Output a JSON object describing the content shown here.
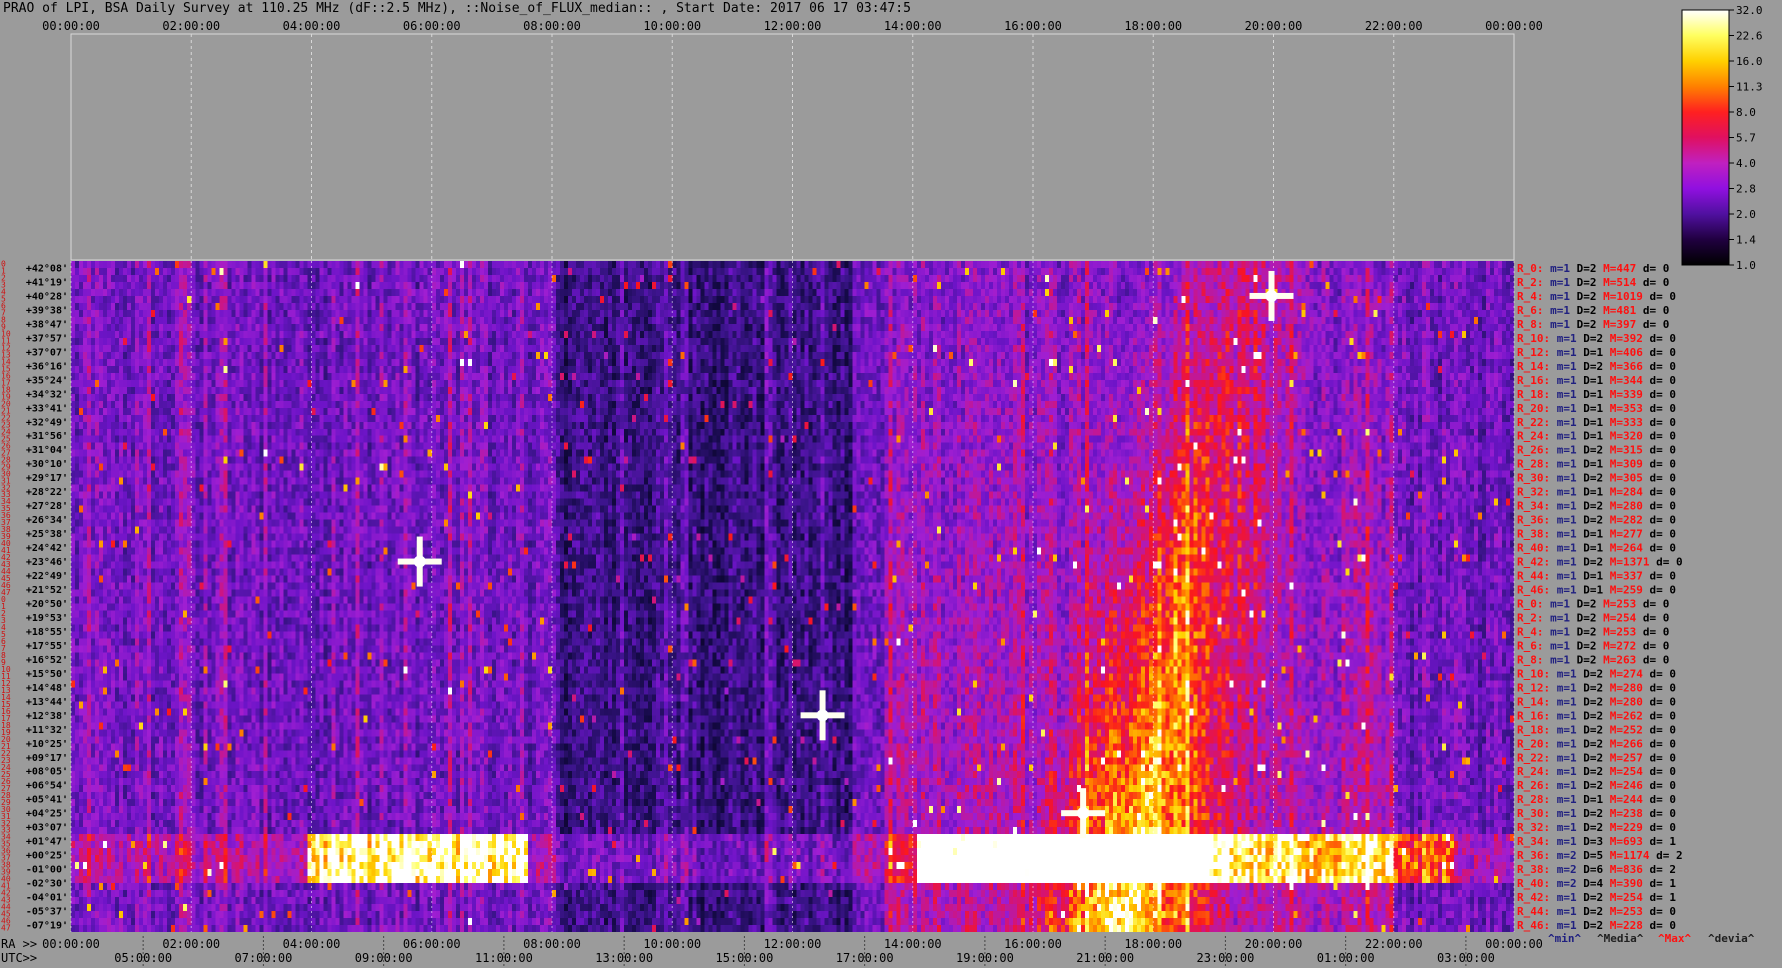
{
  "title": "PRAO of LPI, BSA Daily Survey at 110.25 MHz (dF::2.5 MHz), ::Noise_of_FLUX_median:: , Start Date: 2017 06 17 03:47:5",
  "colors": {
    "background": "#9b9b9b",
    "stat_red": "#ff1010",
    "stat_dark": "#202080",
    "grid": "#ffffff"
  },
  "chart_data": {
    "type": "heatmap",
    "title": "PRAO of LPI, BSA Daily Survey at 110.25 MHz (dF::2.5 MHz), ::Noise_of_FLUX_median:: , Start Date: 2017 06 17 03:47:5",
    "x_top_ticks": [
      "00:00:00",
      "02:00:00",
      "04:00:00",
      "06:00:00",
      "08:00:00",
      "10:00:00",
      "12:00:00",
      "14:00:00",
      "16:00:00",
      "18:00:00",
      "20:00:00",
      "22:00:00",
      "00:00:00"
    ],
    "ra_prefix": "RA >>",
    "utc_prefix": "UTC>>",
    "x_ra_ticks": [
      "00:00:00",
      "02:00:00",
      "04:00:00",
      "06:00:00",
      "08:00:00",
      "10:00:00",
      "12:00:00",
      "14:00:00",
      "16:00:00",
      "18:00:00",
      "20:00:00",
      "22:00:00",
      "00:00:00"
    ],
    "x_utc_ticks": [
      "05:00:00",
      "07:00:00",
      "09:00:00",
      "11:00:00",
      "13:00:00",
      "15:00:00",
      "17:00:00",
      "19:00:00",
      "21:00:00",
      "23:00:00",
      "01:00:00",
      "03:00:00"
    ],
    "dec_labels": [
      "+42°08'",
      "+41°19'",
      "+40°28'",
      "+39°38'",
      "+38°47'",
      "+37°57'",
      "+37°07'",
      "+36°16'",
      "+35°24'",
      "+34°32'",
      "+33°41'",
      "+32°49'",
      "+31°56'",
      "+31°04'",
      "+30°10'",
      "+29°17'",
      "+28°22'",
      "+27°28'",
      "+26°34'",
      "+25°38'",
      "+24°42'",
      "+23°46'",
      "+22°49'",
      "+21°52'",
      "+20°50'",
      "+19°53'",
      "+18°55'",
      "+17°55'",
      "+16°52'",
      "+15°50'",
      "+14°48'",
      "+13°44'",
      "+12°38'",
      "+11°32'",
      "+10°25'",
      "+09°17'",
      "+08°05'",
      "+06°54'",
      "+05°41'",
      "+04°25'",
      "+03°07'",
      "+01°47'",
      "+00°25'",
      "-01°00'",
      "-02°30'",
      "-04°01'",
      "-05°37'",
      "-07°19'"
    ],
    "row_numbers": [
      "0",
      "1",
      "2",
      "3",
      "4",
      "5",
      "6",
      "7",
      "8",
      "9",
      "10",
      "11",
      "12",
      "13",
      "14",
      "15",
      "16",
      "17",
      "18",
      "19",
      "20",
      "21",
      "22",
      "23",
      "24",
      "25",
      "26",
      "27",
      "28",
      "29",
      "30",
      "31",
      "32",
      "33",
      "34",
      "35",
      "36",
      "37",
      "38",
      "39",
      "40",
      "41",
      "42",
      "43",
      "44",
      "45",
      "46",
      "47",
      "0",
      "1",
      "2",
      "3",
      "4",
      "5",
      "6",
      "7",
      "8",
      "9",
      "10",
      "11",
      "12",
      "13",
      "14",
      "15",
      "16",
      "17",
      "18",
      "19",
      "20",
      "21",
      "22",
      "23",
      "24",
      "25",
      "26",
      "27",
      "28",
      "29",
      "30",
      "31",
      "32",
      "33",
      "34",
      "35",
      "36",
      "37",
      "38",
      "39",
      "40",
      "41",
      "42",
      "43",
      "44",
      "45",
      "46",
      "47"
    ],
    "beam_stats": [
      {
        "r": "R_0:",
        "m": "m=1",
        "d": "D=2",
        "M": "M=447",
        "dev": "d= 0"
      },
      {
        "r": "R_2:",
        "m": "m=1",
        "d": "D=2",
        "M": "M=514",
        "dev": "d= 0"
      },
      {
        "r": "R_4:",
        "m": "m=1",
        "d": "D=2",
        "M": "M=1019",
        "dev": "d= 0"
      },
      {
        "r": "R_6:",
        "m": "m=1",
        "d": "D=2",
        "M": "M=481",
        "dev": "d= 0"
      },
      {
        "r": "R_8:",
        "m": "m=1",
        "d": "D=2",
        "M": "M=397",
        "dev": "d= 0"
      },
      {
        "r": "R_10:",
        "m": "m=1",
        "d": "D=2",
        "M": "M=392",
        "dev": "d= 0"
      },
      {
        "r": "R_12:",
        "m": "m=1",
        "d": "D=1",
        "M": "M=406",
        "dev": "d= 0"
      },
      {
        "r": "R_14:",
        "m": "m=1",
        "d": "D=2",
        "M": "M=366",
        "dev": "d= 0"
      },
      {
        "r": "R_16:",
        "m": "m=1",
        "d": "D=1",
        "M": "M=344",
        "dev": "d= 0"
      },
      {
        "r": "R_18:",
        "m": "m=1",
        "d": "D=1",
        "M": "M=339",
        "dev": "d= 0"
      },
      {
        "r": "R_20:",
        "m": "m=1",
        "d": "D=1",
        "M": "M=353",
        "dev": "d= 0"
      },
      {
        "r": "R_22:",
        "m": "m=1",
        "d": "D=1",
        "M": "M=333",
        "dev": "d= 0"
      },
      {
        "r": "R_24:",
        "m": "m=1",
        "d": "D=1",
        "M": "M=320",
        "dev": "d= 0"
      },
      {
        "r": "R_26:",
        "m": "m=1",
        "d": "D=2",
        "M": "M=315",
        "dev": "d= 0"
      },
      {
        "r": "R_28:",
        "m": "m=1",
        "d": "D=1",
        "M": "M=309",
        "dev": "d= 0"
      },
      {
        "r": "R_30:",
        "m": "m=1",
        "d": "D=2",
        "M": "M=305",
        "dev": "d= 0"
      },
      {
        "r": "R_32:",
        "m": "m=1",
        "d": "D=1",
        "M": "M=284",
        "dev": "d= 0"
      },
      {
        "r": "R_34:",
        "m": "m=1",
        "d": "D=2",
        "M": "M=280",
        "dev": "d= 0"
      },
      {
        "r": "R_36:",
        "m": "m=1",
        "d": "D=2",
        "M": "M=282",
        "dev": "d= 0"
      },
      {
        "r": "R_38:",
        "m": "m=1",
        "d": "D=1",
        "M": "M=277",
        "dev": "d= 0"
      },
      {
        "r": "R_40:",
        "m": "m=1",
        "d": "D=1",
        "M": "M=264",
        "dev": "d= 0"
      },
      {
        "r": "R_42:",
        "m": "m=1",
        "d": "D=2",
        "M": "M=1371",
        "dev": "d= 0"
      },
      {
        "r": "R_44:",
        "m": "m=1",
        "d": "D=1",
        "M": "M=337",
        "dev": "d= 0"
      },
      {
        "r": "R_46:",
        "m": "m=1",
        "d": "D=1",
        "M": "M=259",
        "dev": "d= 0"
      },
      {
        "r": "R_0:",
        "m": "m=1",
        "d": "D=2",
        "M": "M=253",
        "dev": "d= 0"
      },
      {
        "r": "R_2:",
        "m": "m=1",
        "d": "D=2",
        "M": "M=254",
        "dev": "d= 0"
      },
      {
        "r": "R_4:",
        "m": "m=1",
        "d": "D=2",
        "M": "M=253",
        "dev": "d= 0"
      },
      {
        "r": "R_6:",
        "m": "m=1",
        "d": "D=2",
        "M": "M=272",
        "dev": "d= 0"
      },
      {
        "r": "R_8:",
        "m": "m=1",
        "d": "D=2",
        "M": "M=263",
        "dev": "d= 0"
      },
      {
        "r": "R_10:",
        "m": "m=1",
        "d": "D=2",
        "M": "M=274",
        "dev": "d= 0"
      },
      {
        "r": "R_12:",
        "m": "m=1",
        "d": "D=2",
        "M": "M=280",
        "dev": "d= 0"
      },
      {
        "r": "R_14:",
        "m": "m=1",
        "d": "D=2",
        "M": "M=280",
        "dev": "d= 0"
      },
      {
        "r": "R_16:",
        "m": "m=1",
        "d": "D=2",
        "M": "M=262",
        "dev": "d= 0"
      },
      {
        "r": "R_18:",
        "m": "m=1",
        "d": "D=2",
        "M": "M=252",
        "dev": "d= 0"
      },
      {
        "r": "R_20:",
        "m": "m=1",
        "d": "D=2",
        "M": "M=266",
        "dev": "d= 0"
      },
      {
        "r": "R_22:",
        "m": "m=1",
        "d": "D=2",
        "M": "M=257",
        "dev": "d= 0"
      },
      {
        "r": "R_24:",
        "m": "m=1",
        "d": "D=2",
        "M": "M=254",
        "dev": "d= 0"
      },
      {
        "r": "R_26:",
        "m": "m=1",
        "d": "D=2",
        "M": "M=246",
        "dev": "d= 0"
      },
      {
        "r": "R_28:",
        "m": "m=1",
        "d": "D=1",
        "M": "M=244",
        "dev": "d= 0"
      },
      {
        "r": "R_30:",
        "m": "m=1",
        "d": "D=2",
        "M": "M=238",
        "dev": "d= 0"
      },
      {
        "r": "R_32:",
        "m": "m=1",
        "d": "D=2",
        "M": "M=229",
        "dev": "d= 0"
      },
      {
        "r": "R_34:",
        "m": "m=1",
        "d": "D=3",
        "M": "M=693",
        "dev": "d= 1"
      },
      {
        "r": "R_36:",
        "m": "m=2",
        "d": "D=5",
        "M": "M=1174",
        "dev": "d= 2"
      },
      {
        "r": "R_38:",
        "m": "m=2",
        "d": "D=6",
        "M": "M=836",
        "dev": "d= 2"
      },
      {
        "r": "R_40:",
        "m": "m=2",
        "d": "D=4",
        "M": "M=390",
        "dev": "d= 1"
      },
      {
        "r": "R_42:",
        "m": "m=1",
        "d": "D=2",
        "M": "M=254",
        "dev": "d= 1"
      },
      {
        "r": "R_44:",
        "m": "m=1",
        "d": "D=2",
        "M": "M=253",
        "dev": "d= 0"
      },
      {
        "r": "R_46:",
        "m": "m=1",
        "d": "D=2",
        "M": "M=228",
        "dev": "d= 0"
      }
    ],
    "footer_legend": [
      {
        "text": "^min^",
        "color": "#202080"
      },
      {
        "text": "^Media^",
        "color": "#202020"
      },
      {
        "text": "^Max^",
        "color": "#ff1010"
      },
      {
        "text": "^devia^",
        "color": "#202020"
      }
    ],
    "colorbar": {
      "ticks": [
        "32.0",
        "22.6",
        "16.0",
        "11.3",
        "8.0",
        "5.7",
        "4.0",
        "2.8",
        "2.0",
        "1.4",
        "1.0"
      ],
      "colors": [
        "#ffffff",
        "#ffff60",
        "#ffd000",
        "#ff8000",
        "#ff2020",
        "#e01060",
        "#c020c0",
        "#9010e0",
        "#5010a0",
        "#200040",
        "#000000"
      ],
      "scale": "log"
    },
    "features": {
      "strong_sources": [
        {
          "ra": "05:48:00",
          "dec": "+23°46'"
        },
        {
          "ra": "19:58:00",
          "dec": "+40°28'"
        },
        {
          "ra": "12:30:00",
          "dec": "+12°38'"
        },
        {
          "ra": "16:50:00",
          "dec": "+04°25'"
        }
      ]
    }
  }
}
